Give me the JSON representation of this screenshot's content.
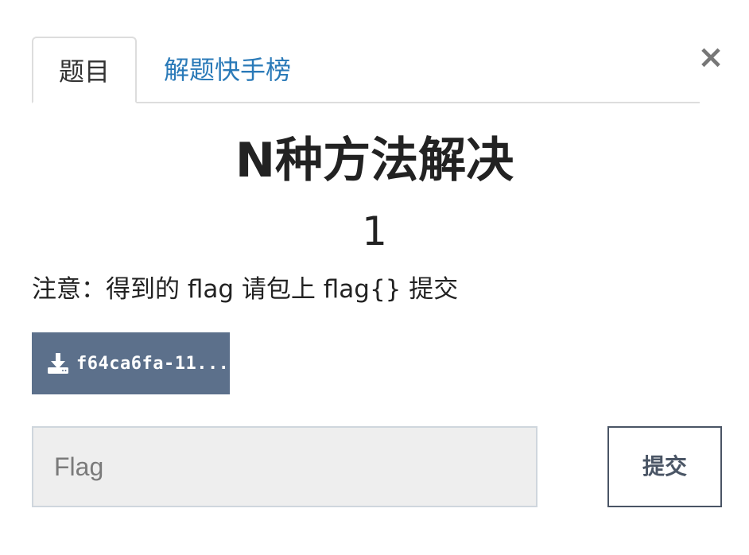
{
  "tabs": {
    "challenge_label": "题目",
    "solves_label": "解题快手榜"
  },
  "close_glyph": "×",
  "challenge": {
    "name": "N种方法解决",
    "value": "1",
    "description": "注意：得到的 flag 请包上 flag{} 提交",
    "file_name": "f64ca6fa-11..."
  },
  "form": {
    "flag_placeholder": "Flag",
    "flag_value": "",
    "submit_label": "提交"
  },
  "icons": {
    "download": "download-icon",
    "close": "close-icon"
  },
  "colors": {
    "tab_link": "#2a7ab8",
    "file_button_bg": "#5c708b",
    "input_bg": "#eeeeee",
    "submit_border": "#4a5565"
  }
}
